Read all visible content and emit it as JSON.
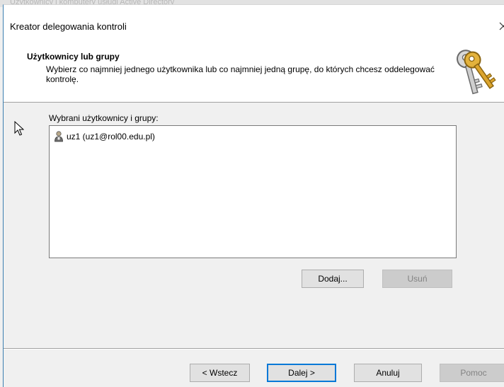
{
  "window": {
    "title": "Kreator delegowania kontroli",
    "close_icon": "close-icon",
    "background_title_faded": "Użytkownicy i komputery usługi Active Directory"
  },
  "header": {
    "title": "Użytkownicy lub grupy",
    "description": "Wybierz co najmniej jednego użytkownika lub co najmniej jedną grupę, do których chcesz oddelegować kontrolę.",
    "icon": "keys-icon"
  },
  "main": {
    "list_label": "Wybrani użytkownicy i grupy:",
    "items": [
      {
        "label": "uz1 (uz1@rol00.edu.pl)",
        "icon": "user-icon"
      }
    ],
    "add_button": "Dodaj...",
    "remove_button": "Usuń"
  },
  "footer": {
    "back_button": "< Wstecz",
    "next_button": "Dalej >",
    "cancel_button": "Anuluj",
    "help_button": "Pomoc"
  },
  "colors": {
    "accent": "#0078d7",
    "window_bg": "#f0f0f0",
    "header_bg": "#ffffff",
    "disabled_text": "#838383"
  }
}
